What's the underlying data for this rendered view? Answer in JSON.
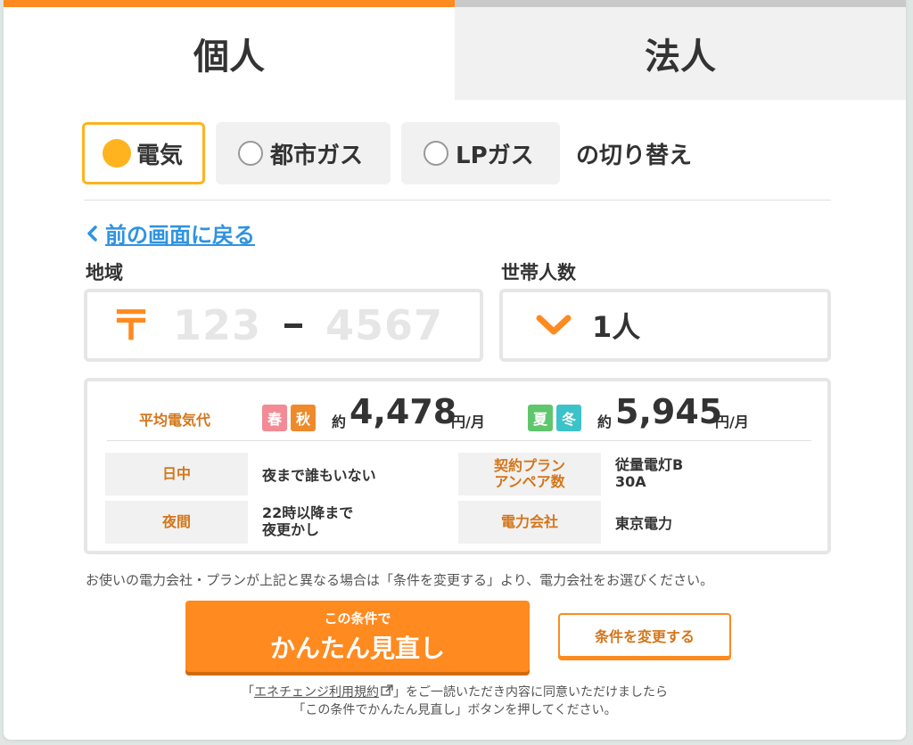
{
  "tabs": [
    {
      "label": "個人",
      "active": true
    },
    {
      "label": "法人",
      "active": false
    }
  ],
  "energy": {
    "options": [
      {
        "label": "電気",
        "selected": true
      },
      {
        "label": "都市ガス",
        "selected": false
      },
      {
        "label": "LPガス",
        "selected": false
      }
    ],
    "suffix": "の切り替え"
  },
  "back_link": "前の画面に戻る",
  "region": {
    "label": "地域",
    "postal_mark": "〒",
    "zip1_placeholder": "123",
    "zip2_placeholder": "4567"
  },
  "household": {
    "label": "世帯人数",
    "value": "1人"
  },
  "average": {
    "label": "平均電気代",
    "spring_autumn": {
      "tags": [
        "春",
        "秋"
      ],
      "prefix": "約",
      "value": "4,478",
      "unit": "円/月"
    },
    "summer_winter": {
      "tags": [
        "夏",
        "冬"
      ],
      "prefix": "約",
      "value": "5,945",
      "unit": "円/月"
    }
  },
  "details": {
    "daytime_label": "日中",
    "daytime_value": "夜まで誰もいない",
    "night_label": "夜間",
    "night_value": "22時以降まで\n夜更かし",
    "plan_label_1": "契約プラン",
    "plan_label_2": "アンペア数",
    "plan_value": "従量電灯B\n30A",
    "company_label": "電力会社",
    "company_value": "東京電力"
  },
  "note": "お使いの電力会社・プランが上記と異なる場合は「条件を変更する」より、電力会社をお選びください。",
  "primary_button": {
    "small": "この条件で",
    "big": "かんたん見直し"
  },
  "secondary_button": "条件を変更する",
  "terms": {
    "open": "「",
    "link": "エネチェンジ利用規約",
    "rest1": "」をご一読いただき内容に同意いただけましたら",
    "line2": "「この条件でかんたん見直し」ボタンを押してください。"
  },
  "colors": {
    "accent": "#ff8a1f",
    "highlight": "#ffb31f",
    "link": "#2f93e0",
    "spring": "#f28b95",
    "autumn": "#ef8a2a",
    "summer": "#5fc66d",
    "winter": "#3cc3c9"
  }
}
